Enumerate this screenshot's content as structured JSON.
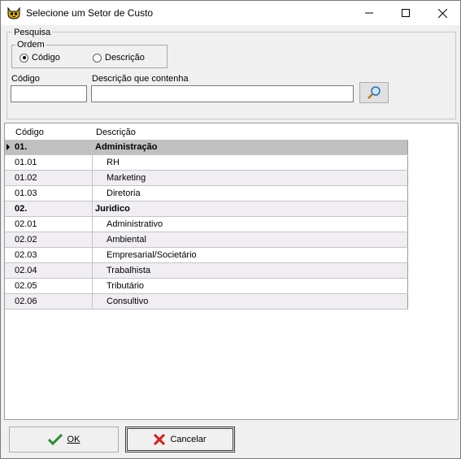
{
  "window": {
    "title": "Selecione um Setor de Custo",
    "minimize_label": "minimize",
    "maximize_label": "maximize",
    "close_label": "close"
  },
  "search": {
    "group_label": "Pesquisa",
    "order_label": "Ordem",
    "order_options": [
      {
        "label": "Código",
        "checked": true
      },
      {
        "label": "Descrição",
        "checked": false
      }
    ],
    "code_label": "Código",
    "code_value": "",
    "desc_label": "Descrição que contenha",
    "desc_value": ""
  },
  "grid": {
    "columns": [
      "Código",
      "Descrição"
    ],
    "rows": [
      {
        "code": "01.",
        "desc": "Administração",
        "group": true,
        "selected": true
      },
      {
        "code": "01.01",
        "desc": "RH",
        "group": false
      },
      {
        "code": "01.02",
        "desc": "Marketing",
        "group": false
      },
      {
        "code": "01.03",
        "desc": "Diretoria",
        "group": false
      },
      {
        "code": "02.",
        "desc": "Juridico",
        "group": true
      },
      {
        "code": "02.01",
        "desc": "Administrativo",
        "group": false
      },
      {
        "code": "02.02",
        "desc": "Ambiental",
        "group": false
      },
      {
        "code": "02.03",
        "desc": "Empresarial/Societário",
        "group": false
      },
      {
        "code": "02.04",
        "desc": "Trabalhista",
        "group": false
      },
      {
        "code": "02.05",
        "desc": "Tributário",
        "group": false
      },
      {
        "code": "02.06",
        "desc": "Consultivo",
        "group": false
      }
    ]
  },
  "footer": {
    "ok_label": "OK",
    "cancel_label": "Cancelar"
  },
  "colors": {
    "ok_check": "#2e8b2e",
    "cancel_x": "#d42020",
    "selected_row": "#c0c0c0"
  }
}
